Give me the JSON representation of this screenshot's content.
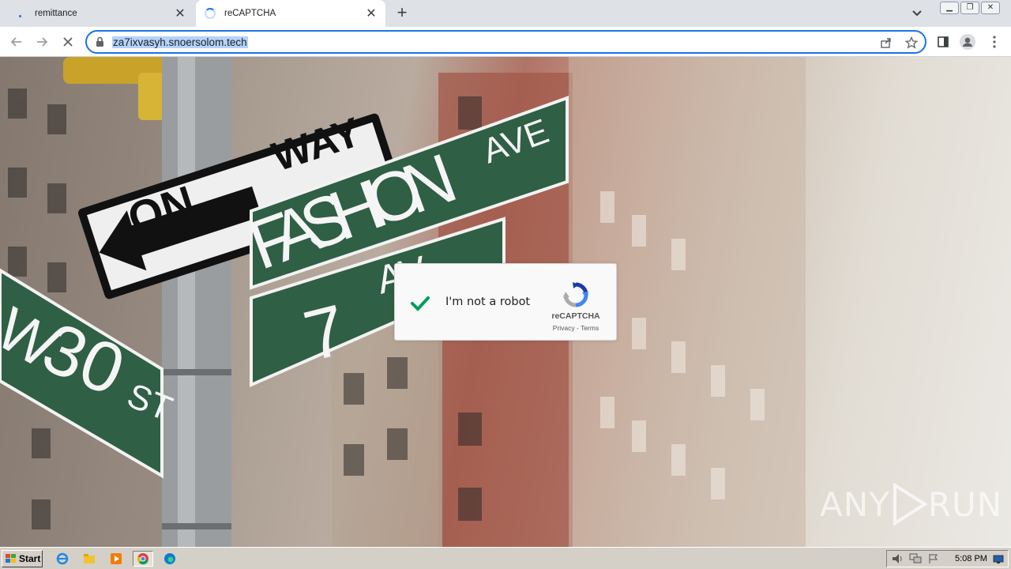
{
  "browser": {
    "tabs": [
      {
        "label": "remittance",
        "state": "inactive"
      },
      {
        "label": "reCAPTCHA",
        "state": "active-loading"
      }
    ],
    "url": "za7ixvasyh.snoersolom.tech",
    "window_buttons": [
      "minimize",
      "restore",
      "close"
    ]
  },
  "page": {
    "background_signs": {
      "way": "WAY",
      "one_way_fragment": "ON",
      "fashion": "FASHION",
      "ave": "AVE",
      "seventh": "7",
      "seventh_suffix": "AV",
      "street_number": "30",
      "street_suffix": "ST",
      "street_prefix": "W"
    },
    "captcha": {
      "checked": true,
      "label": "I'm not a robot",
      "brand": "reCAPTCHA",
      "privacy": "Privacy",
      "separator": " - ",
      "terms": "Terms"
    },
    "watermark": {
      "left": "ANY",
      "right": "RUN"
    }
  },
  "taskbar": {
    "start_label": "Start",
    "apps": [
      "internet-explorer",
      "file-explorer",
      "media-player",
      "chrome",
      "edge"
    ],
    "clock": "5:08 PM"
  },
  "colors": {
    "accent": "#1a73e8",
    "sign_green": "#2f5f45",
    "check_green": "#009e55"
  }
}
